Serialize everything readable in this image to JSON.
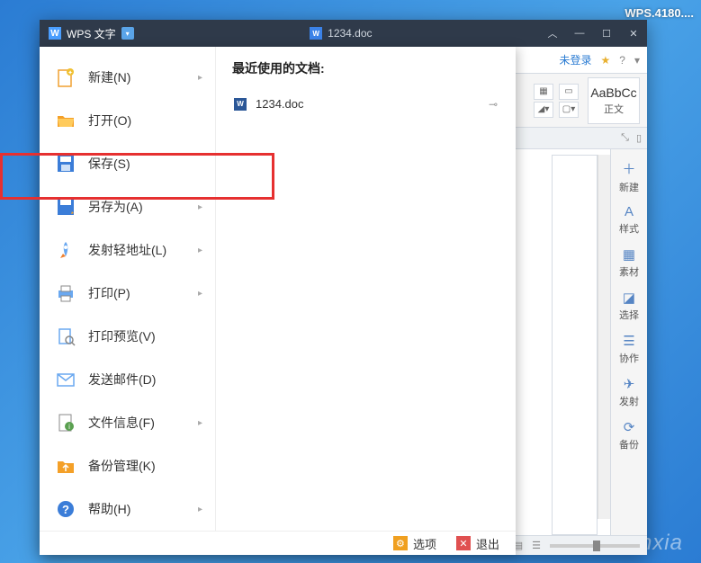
{
  "watermarks": {
    "top": "WPS.4180....",
    "bottom": "Anxia"
  },
  "titlebar": {
    "app": "WPS 文字",
    "doc": "1234.doc"
  },
  "login_text": "未登录",
  "style_box": {
    "preview": "AaBbCc",
    "label": "正文"
  },
  "file_menu": {
    "items": [
      {
        "label": "新建(N)",
        "icon": "new",
        "sub": true
      },
      {
        "label": "打开(O)",
        "icon": "open",
        "sub": false
      },
      {
        "label": "保存(S)",
        "icon": "save",
        "sub": false
      },
      {
        "label": "另存为(A)",
        "icon": "saveas",
        "sub": true
      },
      {
        "label": "发射轻地址(L)",
        "icon": "rocket",
        "sub": true
      },
      {
        "label": "打印(P)",
        "icon": "print",
        "sub": true
      },
      {
        "label": "打印预览(V)",
        "icon": "preview",
        "sub": false
      },
      {
        "label": "发送邮件(D)",
        "icon": "mail",
        "sub": false
      },
      {
        "label": "文件信息(F)",
        "icon": "info",
        "sub": true
      },
      {
        "label": "备份管理(K)",
        "icon": "backup",
        "sub": false
      },
      {
        "label": "帮助(H)",
        "icon": "help",
        "sub": true
      }
    ],
    "recent_header": "最近使用的文档:",
    "recent": [
      {
        "name": "1234.doc"
      }
    ],
    "footer": {
      "options": "选项",
      "exit": "退出"
    }
  },
  "side_panel": [
    {
      "label": "新建",
      "ico": "＋"
    },
    {
      "label": "样式",
      "ico": "A"
    },
    {
      "label": "素材",
      "ico": "▦"
    },
    {
      "label": "选择",
      "ico": "◪"
    },
    {
      "label": "协作",
      "ico": "☰"
    },
    {
      "label": "发射",
      "ico": "✈"
    },
    {
      "label": "备份",
      "ico": "⟳"
    }
  ]
}
